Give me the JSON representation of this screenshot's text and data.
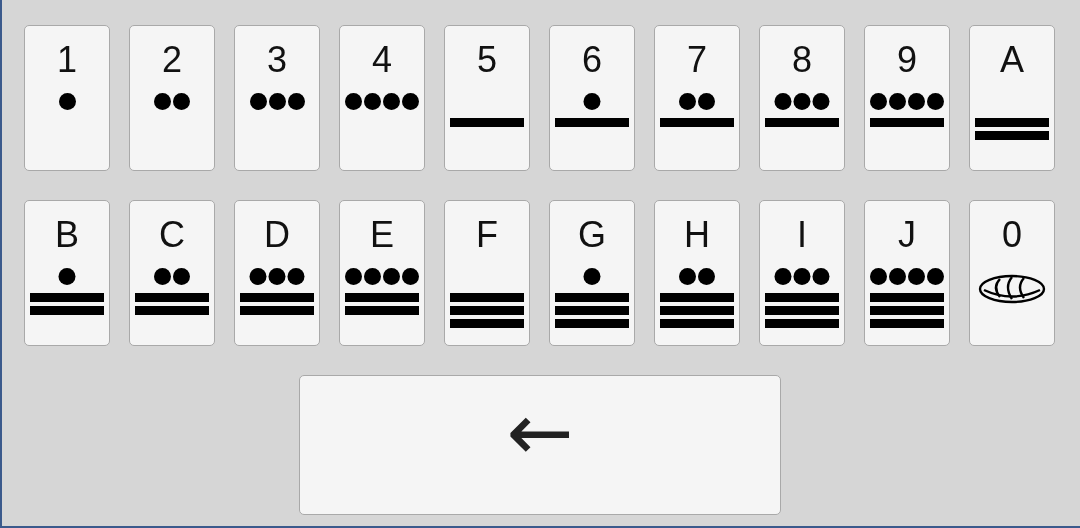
{
  "keyboard": {
    "rows": [
      {
        "keys": [
          {
            "label": "1",
            "kind": "numeral"
          },
          {
            "label": "2",
            "kind": "numeral"
          },
          {
            "label": "3",
            "kind": "numeral"
          },
          {
            "label": "4",
            "kind": "numeral"
          },
          {
            "label": "5",
            "kind": "numeral"
          },
          {
            "label": "6",
            "kind": "numeral"
          },
          {
            "label": "7",
            "kind": "numeral"
          },
          {
            "label": "8",
            "kind": "numeral"
          },
          {
            "label": "9",
            "kind": "numeral"
          },
          {
            "label": "A",
            "kind": "numeral"
          }
        ]
      },
      {
        "keys": [
          {
            "label": "B",
            "kind": "numeral"
          },
          {
            "label": "C",
            "kind": "numeral"
          },
          {
            "label": "D",
            "kind": "numeral"
          },
          {
            "label": "E",
            "kind": "numeral"
          },
          {
            "label": "F",
            "kind": "numeral"
          },
          {
            "label": "G",
            "kind": "numeral"
          },
          {
            "label": "H",
            "kind": "numeral"
          },
          {
            "label": "I",
            "kind": "numeral"
          },
          {
            "label": "J",
            "kind": "numeral"
          },
          {
            "label": "0",
            "kind": "zero"
          }
        ]
      }
    ],
    "backspace": {
      "label": "←"
    }
  }
}
